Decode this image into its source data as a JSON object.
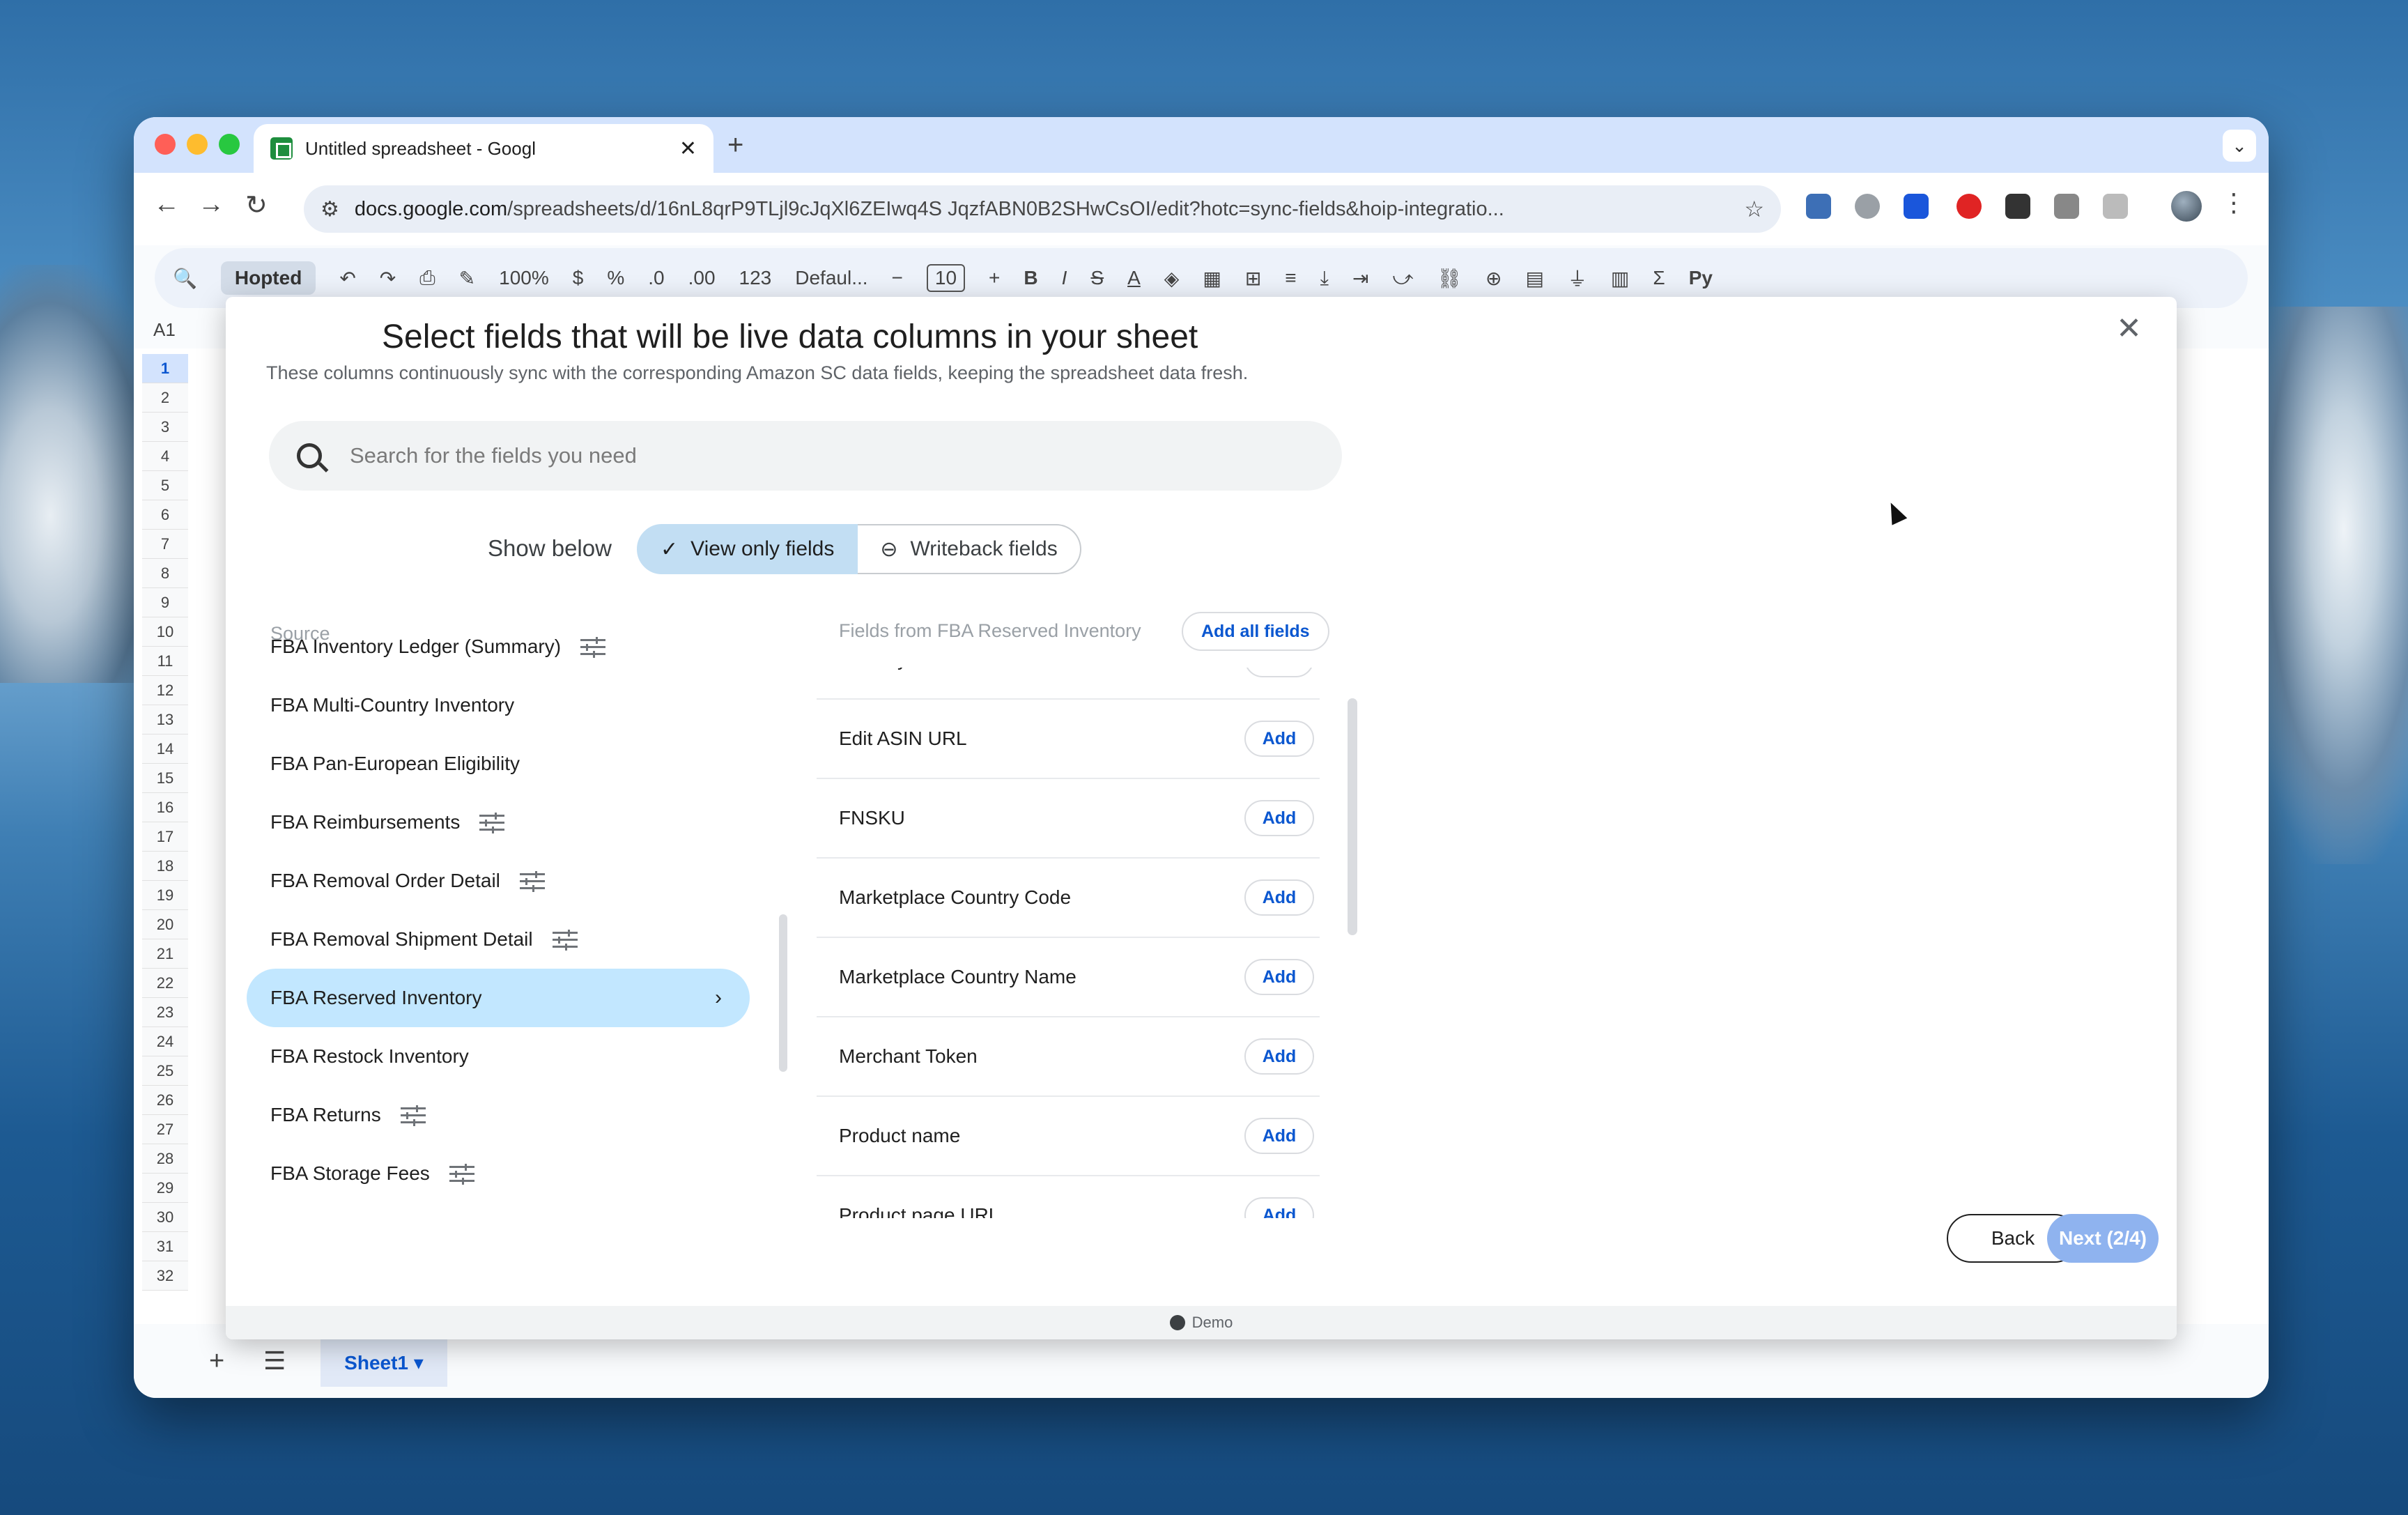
{
  "browser": {
    "tab_title": "Untitled spreadsheet - Googl",
    "tab_close": "✕",
    "new_tab": "+",
    "url_domain": "docs.google.com",
    "url_rest": "/spreadsheets/d/16nL8qrP9TLjl9cJqXl6ZEIwq4S JqzfABN0B2SHwCsOI/edit?hotc=sync-fields&hoip-integratio...",
    "nav_back": "←",
    "nav_forward": "→",
    "nav_reload": "↻",
    "star": "☆",
    "menu": "⋮",
    "chevron": "⌄"
  },
  "sheets": {
    "toolbar": {
      "search": "🔍",
      "hopted": "Hopted",
      "undo": "↶",
      "redo": "↷",
      "zoom": "100%",
      "dollar": "$",
      "percent": "%",
      "dec_less": ".0",
      "dec_more": ".00",
      "num": "123",
      "font": "Defaul...",
      "minus": "−",
      "font_size": "10",
      "plus": "+",
      "bold": "B",
      "italic": "I",
      "strike": "S",
      "textcolor": "A",
      "sum": "Σ",
      "py": "Py"
    },
    "cell_ref": "A1",
    "row_numbers": [
      "1",
      "2",
      "3",
      "4",
      "5",
      "6",
      "7",
      "8",
      "9",
      "10",
      "11",
      "12",
      "13",
      "14",
      "15",
      "16",
      "17",
      "18",
      "19",
      "20",
      "21",
      "22",
      "23",
      "24",
      "25",
      "26",
      "27",
      "28",
      "29",
      "30",
      "31",
      "32"
    ],
    "bottom": {
      "add": "+",
      "list": "☰",
      "sheet_tab": "Sheet1 ▾"
    }
  },
  "modal": {
    "title": "Select fields that will be live data columns in your sheet",
    "subtitle": "These columns continuously sync with the corresponding Amazon SC data fields, keeping the spreadsheet data fresh.",
    "close": "✕",
    "search_placeholder": "Search for the fields you need",
    "show_below": "Show below",
    "view_only": "View only fields",
    "writeback": "Writeback fields",
    "source_label": "Source",
    "sources": [
      {
        "label": "FBA Inventory Ledger (Summary)",
        "settings": true
      },
      {
        "label": "FBA Multi-Country Inventory",
        "settings": false
      },
      {
        "label": "FBA Pan-European Eligibility",
        "settings": false
      },
      {
        "label": "FBA Reimbursements",
        "settings": true
      },
      {
        "label": "FBA Removal Order Detail",
        "settings": true
      },
      {
        "label": "FBA Removal Shipment Detail",
        "settings": true
      },
      {
        "label": "FBA Reserved Inventory",
        "settings": false,
        "active": true
      },
      {
        "label": "FBA Restock Inventory",
        "settings": false
      },
      {
        "label": "FBA Returns",
        "settings": true
      },
      {
        "label": "FBA Storage Fees",
        "settings": true
      }
    ],
    "active_chevron": "›",
    "fields_label": "Fields from FBA Reserved Inventory",
    "add_all": "Add all fields",
    "add_label": "Add",
    "fields": [
      "Country Name",
      "Edit ASIN URL",
      "FNSKU",
      "Marketplace Country Code",
      "Marketplace Country Name",
      "Merchant Token",
      "Product name",
      "Product page URL"
    ],
    "back": "Back",
    "next": "Next (2/4)",
    "footer": "Demo"
  }
}
